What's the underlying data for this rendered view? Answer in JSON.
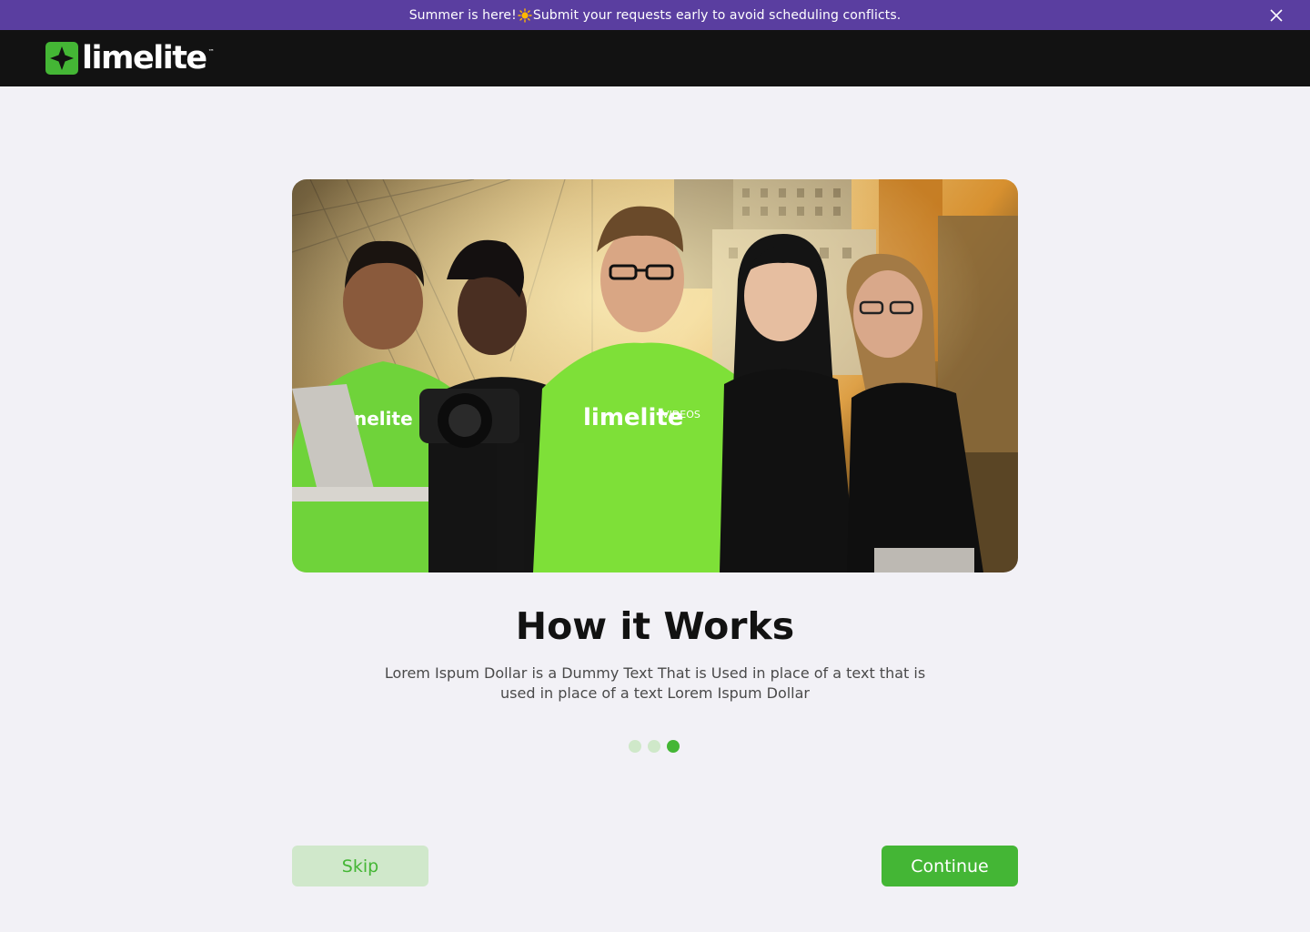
{
  "announcement": {
    "text_before": "Summer is here!",
    "text_after": "Submit your requests early to avoid scheduling conflicts.",
    "emoji_icon": "sun-icon",
    "background": "#5a3ea0"
  },
  "header": {
    "logo_text": "limelite",
    "logo_tm": "™",
    "background": "#121212"
  },
  "hero": {
    "shirt_text_main": "limelite",
    "shirt_text_sub": "VIDEOS",
    "shirt_text_left": "nelite"
  },
  "onboarding": {
    "title": "How it Works",
    "description": "Lorem Ispum Dollar is a Dummy Text That is Used in place of a text that is used in place of a text Lorem Ispum Dollar",
    "step_count": 3,
    "active_step": 3
  },
  "actions": {
    "skip_label": "Skip",
    "continue_label": "Continue"
  },
  "colors": {
    "brand_green": "#44b635",
    "light_green": "#d0e8cb",
    "page_background": "#f2f1f6"
  }
}
